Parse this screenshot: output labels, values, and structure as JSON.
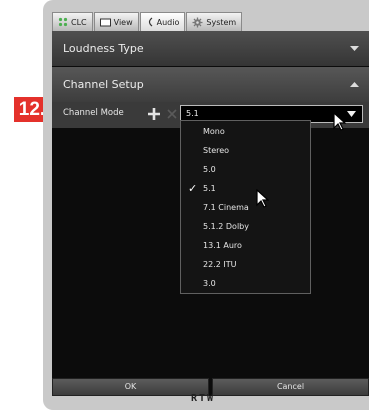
{
  "step_badge": "12.",
  "tabs": [
    {
      "label": "CLC",
      "icon": "clc-icon"
    },
    {
      "label": "View",
      "icon": "monitor-icon"
    },
    {
      "label": "Audio",
      "icon": "audio-icon"
    },
    {
      "label": "System",
      "icon": "gear-icon"
    }
  ],
  "active_tab": "Audio",
  "sections": {
    "loudness_type": {
      "label": "Loudness Type",
      "expanded": false
    },
    "channel_setup": {
      "label": "Channel Setup",
      "expanded": true
    }
  },
  "channel_mode": {
    "label": "Channel Mode",
    "selected": "5.1",
    "options": [
      "Mono",
      "Stereo",
      "5.0",
      "5.1",
      "7.1 Cinema",
      "5.1.2 Dolby",
      "13.1 Auro",
      "22.2 ITU",
      "3.0"
    ],
    "checkmark": "✓"
  },
  "footer": {
    "ok_label": "OK",
    "cancel_label": "Cancel"
  },
  "brand": "RTW",
  "colors": {
    "badge": "#e4312b",
    "screen_bg": "#0c0c0c",
    "header_bg": "#444444"
  }
}
